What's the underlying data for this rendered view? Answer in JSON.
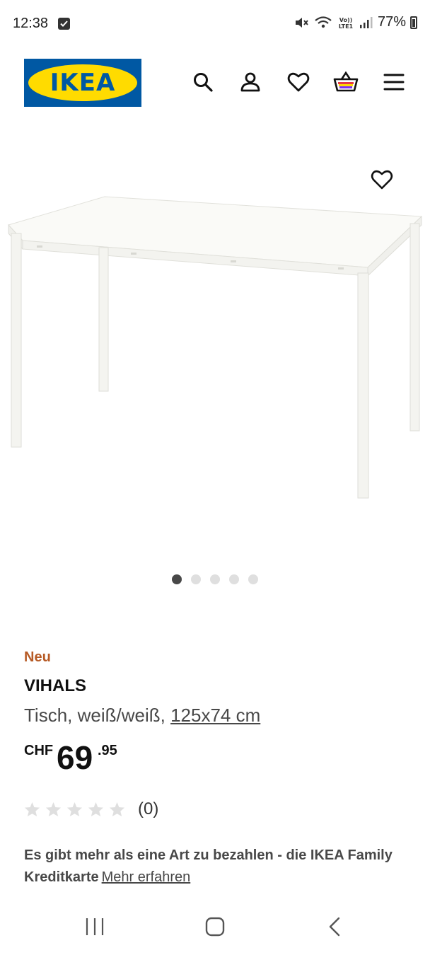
{
  "status_bar": {
    "time": "12:38",
    "battery": "77%",
    "icons": [
      "notification-check-icon",
      "mute-icon",
      "wifi-icon",
      "volte-icon",
      "signal-icon",
      "battery-icon"
    ]
  },
  "header": {
    "logo_text": "IKEA",
    "logo_registered": "®",
    "icons": [
      "search-icon",
      "account-icon",
      "heart-icon",
      "cart-icon",
      "menu-icon"
    ]
  },
  "gallery": {
    "image_count": 5,
    "active_index": 0
  },
  "product": {
    "badge": "Neu",
    "name": "VIHALS",
    "description": "Tisch, weiß/weiß,",
    "size": "125x74 cm",
    "price_currency": "CHF",
    "price_integer": "69",
    "price_decimal": ".95",
    "rating_stars": 0,
    "rating_max": 5,
    "rating_count": "(0)"
  },
  "payment": {
    "text": "Es gibt mehr als eine Art zu bezahlen - die IKEA Family Kreditkarte",
    "link": "Mehr erfahren"
  },
  "colors": {
    "ikea_blue": "#0058a3",
    "ikea_yellow": "#ffdb00",
    "badge_orange": "#b65a25"
  }
}
